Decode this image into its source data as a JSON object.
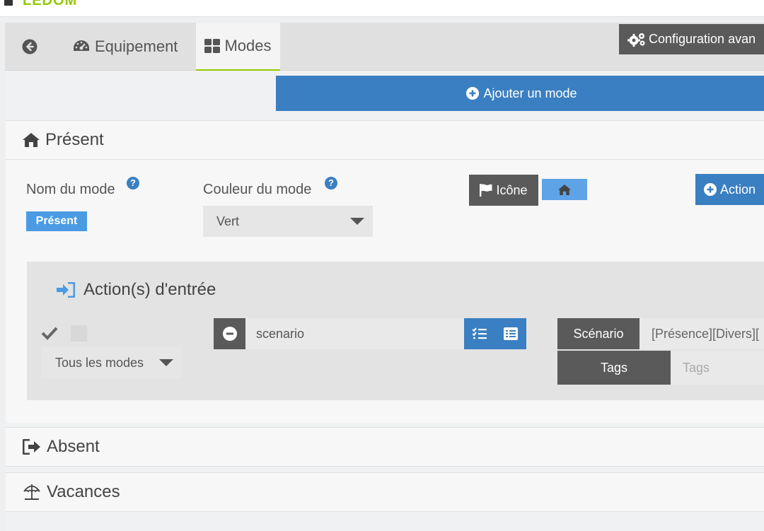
{
  "app": {
    "logo_text": "LEDOM"
  },
  "tabs": {
    "back_icon": "circle-arrow-left-icon",
    "equipement_label": "Equipement",
    "modes_label": "Modes"
  },
  "toolbar": {
    "config_label": "Configuration avan",
    "add_mode_label": "Ajouter un mode"
  },
  "sections": {
    "present": {
      "title": "Présent",
      "icon": "home-icon",
      "nom_label": "Nom du mode",
      "nom_value": "Présent",
      "couleur_label": "Couleur du mode",
      "couleur_value": "Vert",
      "icone_button": "Icône",
      "icon_preview": "home-icon",
      "action_button": "Action",
      "help_glyph": "?",
      "entry": {
        "title": "Action(s) d'entrée",
        "modes_select": "Tous les modes",
        "command_value": "scenario",
        "scenario_label": "Scénario",
        "scenario_value": "[Présence][Divers][",
        "tags_label": "Tags",
        "tags_placeholder": "Tags"
      }
    },
    "absent": {
      "title": "Absent",
      "icon": "sign-out-icon"
    },
    "vacances": {
      "title": "Vacances",
      "icon": "beach-umbrella-icon"
    }
  },
  "colors": {
    "primary": "#3a7fc1",
    "dark_button": "#5a5a5a",
    "badge": "#4a9be3",
    "active_tab_underline": "#93ca02"
  }
}
